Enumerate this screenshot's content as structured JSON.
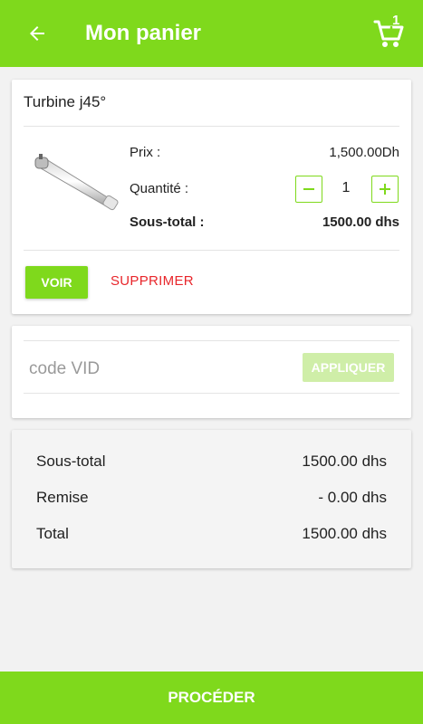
{
  "appbar": {
    "title": "Mon panier",
    "back_icon": "arrow-left-icon",
    "cart_icon": "cart-icon",
    "cart_count": "1",
    "color": "#7fd91c"
  },
  "product": {
    "name": "Turbine j45°",
    "price_label": "Prix :",
    "price_value": "1,500.00Dh",
    "quantity_label": "Quantité :",
    "quantity": "1",
    "subtotal_label": "Sous-total :",
    "subtotal_value": "1500.00 dhs",
    "view_label": "VOIR",
    "delete_label": "SUPPRIMER",
    "delete_color": "#e8262b"
  },
  "promo": {
    "placeholder": "code VID",
    "value": "",
    "apply_label": "APPLIQUER"
  },
  "totals": {
    "subtotal_label": "Sous-total",
    "subtotal_value": "1500.00 dhs",
    "discount_label": "Remise",
    "discount_value": "- 0.00 dhs",
    "total_label": "Total",
    "total_value": "1500.00 dhs"
  },
  "footer": {
    "proceed_label": "PROCÉDER"
  }
}
